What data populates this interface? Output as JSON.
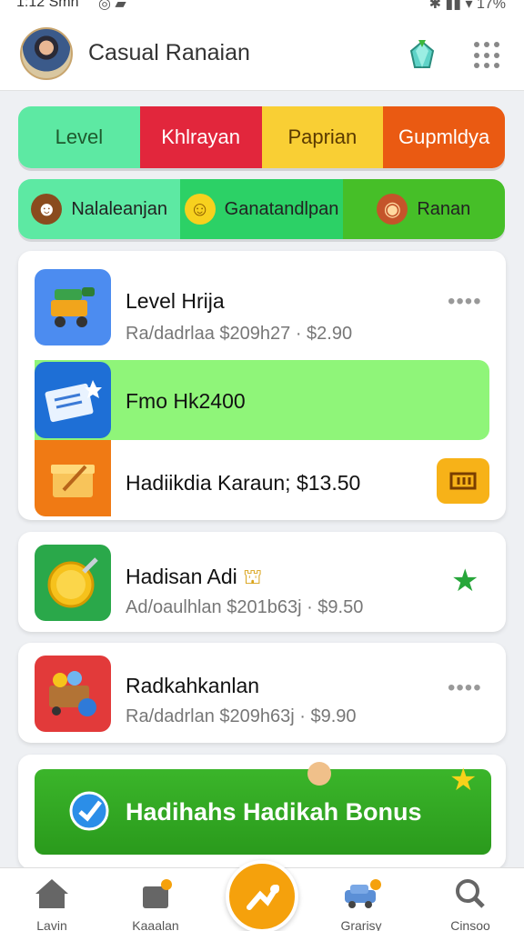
{
  "status": {
    "time": "1:12 Smn",
    "right": "17%"
  },
  "header": {
    "title": "Casual Ranaian"
  },
  "tabs_primary": [
    {
      "label": "Level",
      "bg": "#5de9a3",
      "fg": "#1e5a2e"
    },
    {
      "label": "Khlrayan",
      "bg": "#e2263c",
      "fg": "#ffffff"
    },
    {
      "label": "Paprian",
      "bg": "#f9cf34",
      "fg": "#5a3a00"
    },
    {
      "label": "Gupmldya",
      "bg": "#ea5a12",
      "fg": "#ffffff"
    }
  ],
  "tabs_secondary": [
    {
      "label": "Nalaleanjan",
      "bg": "#5de9a3",
      "icon": "monkey-face-icon"
    },
    {
      "label": "Ganatandlpan",
      "bg": "#2cd166",
      "icon": "smiley-coin-icon"
    },
    {
      "label": "Ranan",
      "bg": "#46bf28",
      "icon": "food-bowl-icon"
    }
  ],
  "list1": {
    "item1": {
      "title": "Level Hrija",
      "subtitle": "Ra/dadrlaa  $209h27 · $2.90",
      "icon": "truck-toy-icon"
    },
    "item2": {
      "title": "Fmo Hk2400",
      "icon": "ticket-card-icon",
      "highlight": "#8ff579"
    },
    "item3": {
      "title": "Hadiikdia Karaun;  $13.50",
      "icon": "gift-box-icon",
      "badge_icon": "coupon-icon"
    }
  },
  "list2": {
    "title": "Hadisan Adi",
    "subtitle": "Ad/oaulhlan  $201b63j · $9.50",
    "icon": "gold-coin-icon",
    "action_icon": "star-icon"
  },
  "list3": {
    "title": "Radkahkanlan",
    "subtitle": "Ra/dadrlan  $209h63j · $9.90",
    "icon": "treasure-cart-icon"
  },
  "banner": {
    "title": "Hadihahs Hadikah Bonus"
  },
  "nav": {
    "items": [
      {
        "label": "Lavin",
        "icon": "home-icon"
      },
      {
        "label": "Kaaalan",
        "icon": "shop-bag-icon"
      },
      {
        "label": "",
        "icon": "center-play-icon"
      },
      {
        "label": "Grarisy",
        "icon": "car-icon"
      },
      {
        "label": "Cinsoo",
        "icon": "search-icon"
      }
    ]
  }
}
